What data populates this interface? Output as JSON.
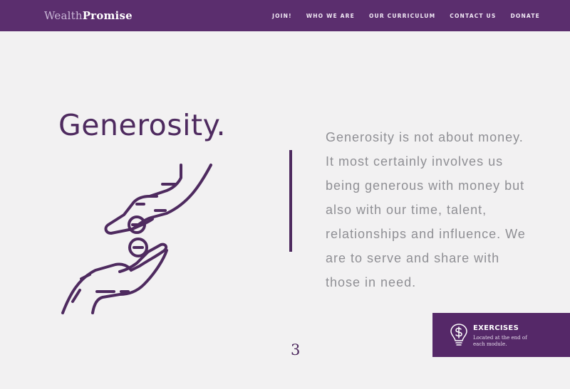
{
  "brand": {
    "logo_wealth": "Wealth",
    "logo_promise": "Promise"
  },
  "nav": {
    "items": [
      "JOIN!",
      "WHO WE ARE",
      "OUR CURRICULUM",
      "CONTACT US",
      "DONATE"
    ]
  },
  "main": {
    "heading": "Generosity.",
    "body": "Generosity is not about money. It most certainly involves us being generous with money but also with our time, talent, relationships and influence. We are to serve and share with those in need.",
    "page_number": "3"
  },
  "exercises": {
    "title": "EXERCISES",
    "subtitle": "Located at the end of each module."
  },
  "colors": {
    "primary": "#5b2e6e",
    "heading": "#4e2a5f",
    "body_text": "#8f8f94",
    "background": "#f2f1f2"
  },
  "icons": [
    "hands-coins-icon",
    "lightbulb-dollar-icon"
  ]
}
